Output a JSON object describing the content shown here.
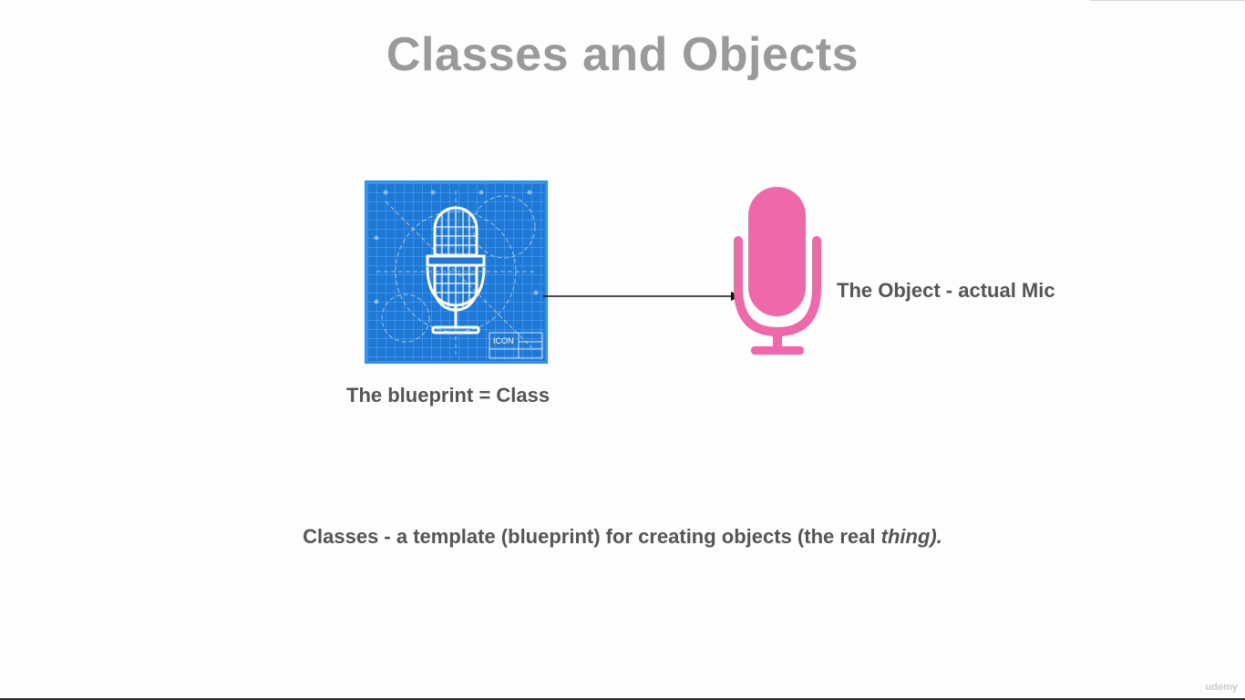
{
  "slide": {
    "title": "Classes and Objects",
    "blueprint_caption": "The blueprint = Class",
    "object_caption": "The Object - actual Mic",
    "definition_main": "Classes - a template (blueprint) for creating objects (the real ",
    "definition_italic": "thing).",
    "blueprint_stamp": "ICON",
    "watermark": "udemy"
  },
  "colors": {
    "title": "#9a9a9a",
    "text": "#555555",
    "blueprint_bg": "#1f78d4",
    "object_mic": "#ee68aa",
    "arrow": "#111111"
  },
  "icons": {
    "blueprint_mic": "microphone-blueprint-icon",
    "object_mic": "microphone-icon",
    "arrow": "arrow-right-icon"
  }
}
